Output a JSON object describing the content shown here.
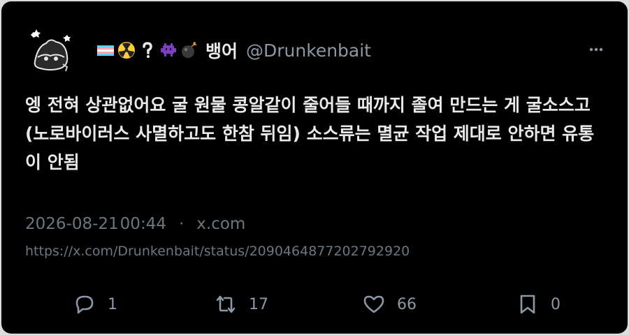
{
  "tweet": {
    "display_name": "뱅어",
    "handle": "@Drunkenbait",
    "name_emojis": [
      "transgender-flag",
      "radioactive-face",
      "question-mark",
      "alien-monster",
      "bomb"
    ],
    "text": "엥 전혀 상관없어요 굴 원물 콩알같이 줄어들 때까지 졸여 만드는 게 굴소스고(노로바이러스 사멸하고도 한참 뒤임) 소스류는 멸균 작업 제대로 안하면 유통이 안됨",
    "date": "2026-08-21",
    "time": "00:44",
    "separator": "·",
    "source": "x.com",
    "url": "https://x.com/Drunkenbait/status/2090464877202792920"
  },
  "actions": {
    "replies": "1",
    "retweets": "17",
    "likes": "66",
    "bookmarks": "0"
  },
  "colors": {
    "background": "#000000",
    "text_primary": "#e7e9ea",
    "text_secondary": "#6e767d"
  },
  "icons": [
    "avatar",
    "more-icon",
    "reply-icon",
    "retweet-icon",
    "like-icon",
    "bookmark-icon"
  ]
}
